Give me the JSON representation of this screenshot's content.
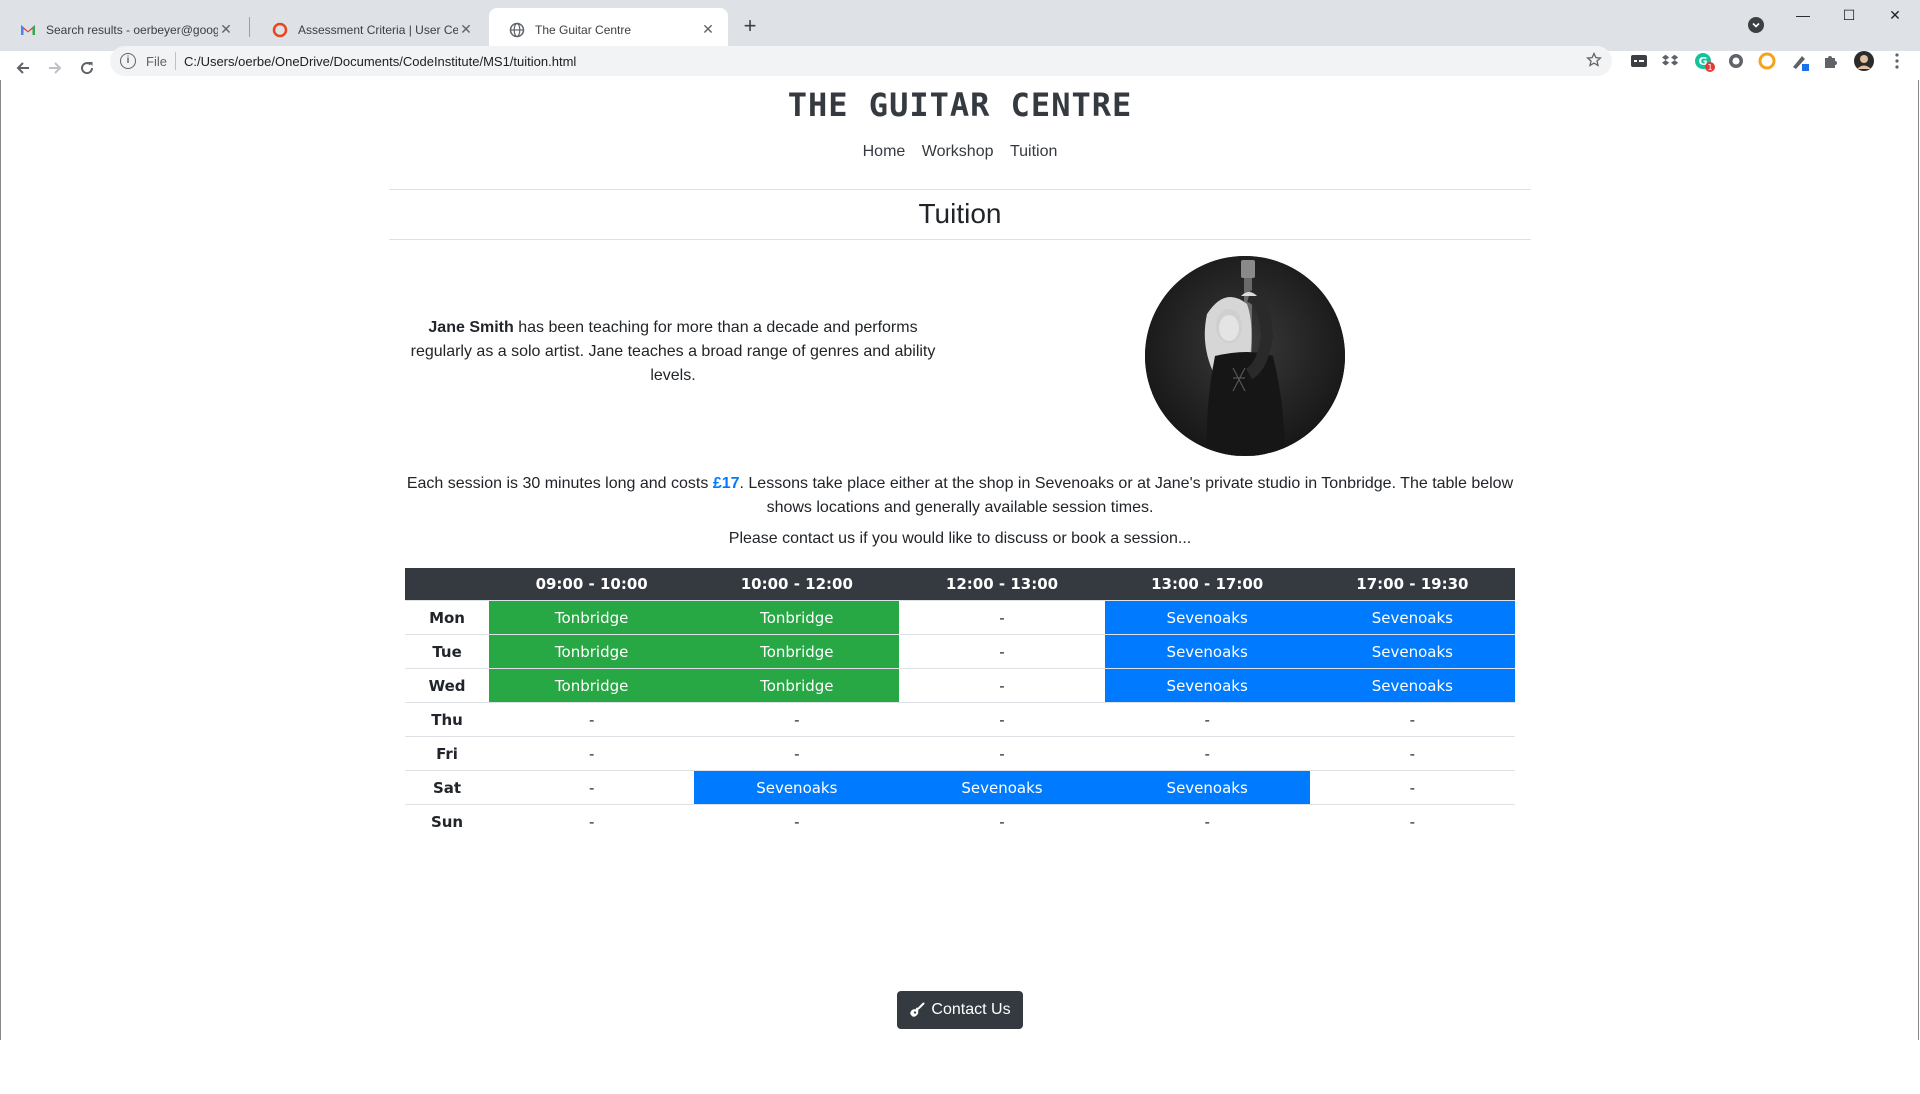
{
  "browser": {
    "tabs": [
      {
        "title": "Search results - oerbeyer@googl",
        "icon": "gmail-icon"
      },
      {
        "title": "Assessment Criteria | User Centric",
        "icon": "code-institute-icon"
      },
      {
        "title": "The Guitar Centre",
        "icon": "globe-icon"
      }
    ],
    "omnibox": {
      "scheme_label": "File",
      "url": "C:/Users/oerbe/OneDrive/Documents/CodeInstitute/MS1/tuition.html"
    },
    "notification_count": "1"
  },
  "site": {
    "title": "THE GUITAR CENTRE",
    "nav": [
      "Home",
      "Workshop",
      "Tuition"
    ]
  },
  "section": {
    "title": "Tuition",
    "teacher_name": "Jane Smith",
    "intro_rest": " has been teaching for more than a decade and performs regularly as a solo artist. Jane teaches a broad range of genres and ability levels.",
    "session_before": "Each session is 30 minutes long and costs ",
    "price": "£17",
    "session_after": ". Lessons take place either at the shop in Sevenoaks or at Jane's private studio in Tonbridge. The table below shows locations and generally available session times.",
    "contact_line": "Please contact us if you would like to discuss or book a session..."
  },
  "timetable": {
    "columns": [
      "09:00 - 10:00",
      "10:00 - 12:00",
      "12:00 - 13:00",
      "13:00 - 17:00",
      "17:00 - 19:30"
    ],
    "rows": [
      {
        "day": "Mon",
        "cells": [
          "Tonbridge",
          "Tonbridge",
          "-",
          "Sevenoaks",
          "Sevenoaks"
        ]
      },
      {
        "day": "Tue",
        "cells": [
          "Tonbridge",
          "Tonbridge",
          "-",
          "Sevenoaks",
          "Sevenoaks"
        ]
      },
      {
        "day": "Wed",
        "cells": [
          "Tonbridge",
          "Tonbridge",
          "-",
          "Sevenoaks",
          "Sevenoaks"
        ]
      },
      {
        "day": "Thu",
        "cells": [
          "-",
          "-",
          "-",
          "-",
          "-"
        ]
      },
      {
        "day": "Fri",
        "cells": [
          "-",
          "-",
          "-",
          "-",
          "-"
        ]
      },
      {
        "day": "Sat",
        "cells": [
          "-",
          "Sevenoaks",
          "Sevenoaks",
          "Sevenoaks",
          "-"
        ]
      },
      {
        "day": "Sun",
        "cells": [
          "-",
          "-",
          "-",
          "-",
          "-"
        ]
      }
    ],
    "colors": {
      "Tonbridge": "#28a745",
      "Sevenoaks": "#007bff",
      "header": "#343a40"
    }
  },
  "contact_button": {
    "label": "Contact Us",
    "icon": "guitar-icon"
  }
}
